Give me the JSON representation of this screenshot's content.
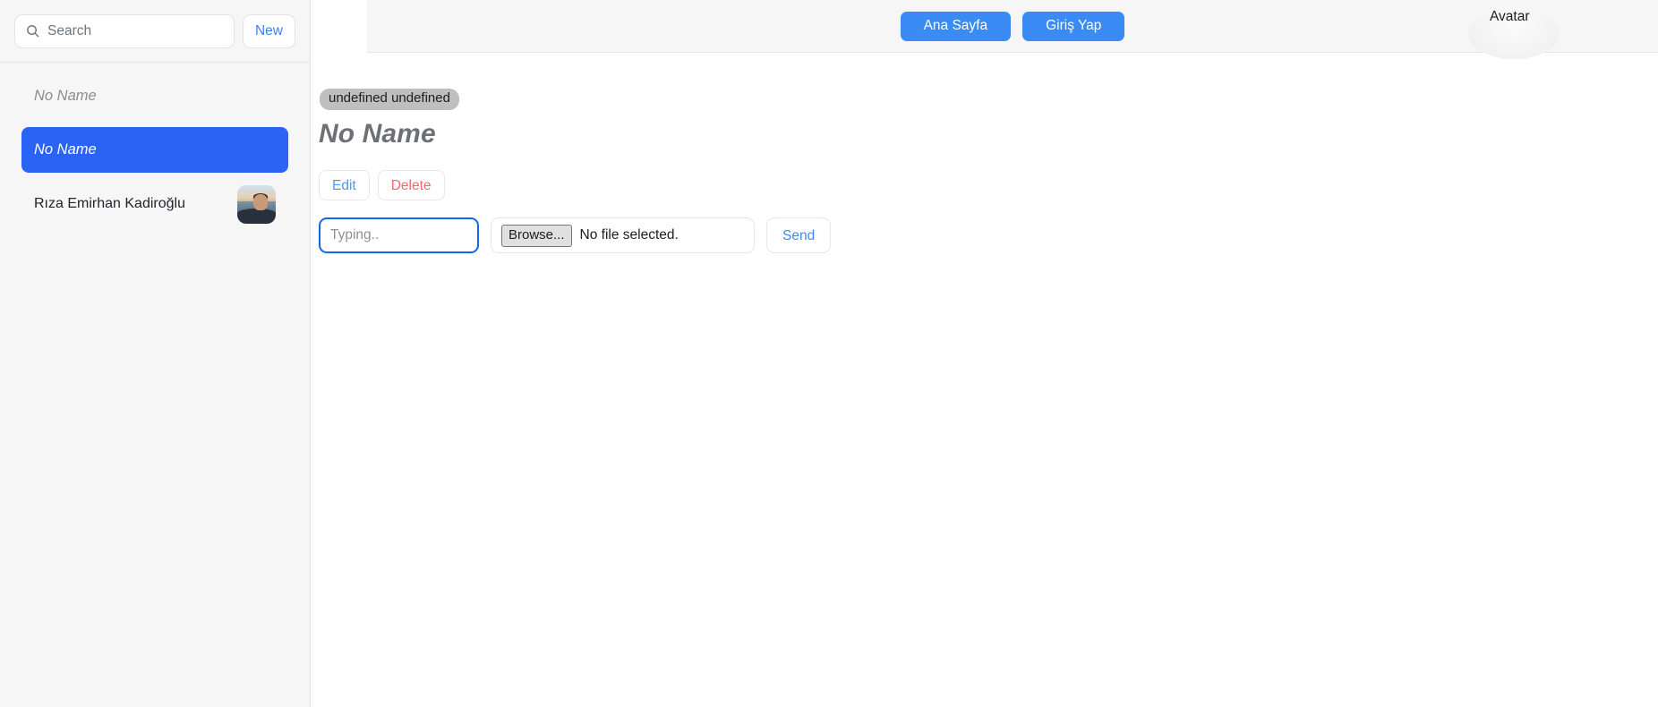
{
  "sidebar": {
    "search": {
      "icon": "search-icon",
      "value": "",
      "placeholder": "Search"
    },
    "new_button_label": "New",
    "conversations": [
      {
        "name": "No Name",
        "style": "muted",
        "selected": false,
        "has_avatar": false
      },
      {
        "name": "No Name",
        "style": "selected",
        "selected": true,
        "has_avatar": false
      },
      {
        "name": "Rıza Emirhan Kadiroğlu",
        "style": "normal",
        "selected": false,
        "has_avatar": true
      }
    ]
  },
  "header": {
    "nav_buttons": [
      {
        "label": "Ana Sayfa"
      },
      {
        "label": "Giriş Yap"
      }
    ],
    "avatar_alt": "Avatar"
  },
  "profile": {
    "badge": "undefined undefined",
    "title": "No Name",
    "actions": [
      {
        "label": "Edit",
        "kind": "edit"
      },
      {
        "label": "Delete",
        "kind": "delete"
      }
    ]
  },
  "message_form": {
    "text_input": {
      "value": "",
      "placeholder": "Typing.."
    },
    "file_input": {
      "browse_label": "Browse...",
      "status": "No file selected."
    },
    "send_label": "Send"
  },
  "colors": {
    "accent_blue": "#2a64f6",
    "nav_blue": "#3b8bf5",
    "link_blue": "#3b82f6",
    "danger_red": "#f2686f",
    "sidebar_bg": "#f6f6f7",
    "header_bg": "#f6f6f6",
    "badge_bg": "#bfbfbf",
    "title_gray": "#6d7074"
  }
}
